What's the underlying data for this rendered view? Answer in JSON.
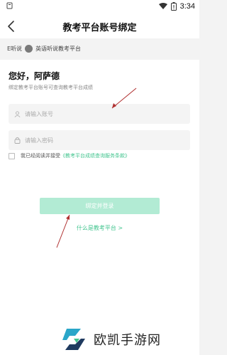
{
  "status_bar": {
    "time": "3:34"
  },
  "header": {
    "title": "教考平台账号绑定",
    "back_icon": "chevron-left-icon"
  },
  "crumb": {
    "source": "E听说",
    "platform": "英语听说教考平台"
  },
  "greeting": "您好，阿萨德",
  "subtext": "绑定教考平台账号可查询教考平台成绩",
  "form": {
    "account_placeholder": "请输入账号",
    "password_placeholder": "请输入密码",
    "agreement_text": "我已经阅读并接受",
    "agreement_link": "《教考平台成绩查询服务条款》",
    "submit_label": "绑定并登录",
    "help_link": "什么是教考平台 >"
  },
  "watermark": {
    "text": "欧凯手游网"
  },
  "colors": {
    "accent": "#43c58f",
    "button_disabled": "#b2ebd4",
    "arrow": "#b03030"
  }
}
